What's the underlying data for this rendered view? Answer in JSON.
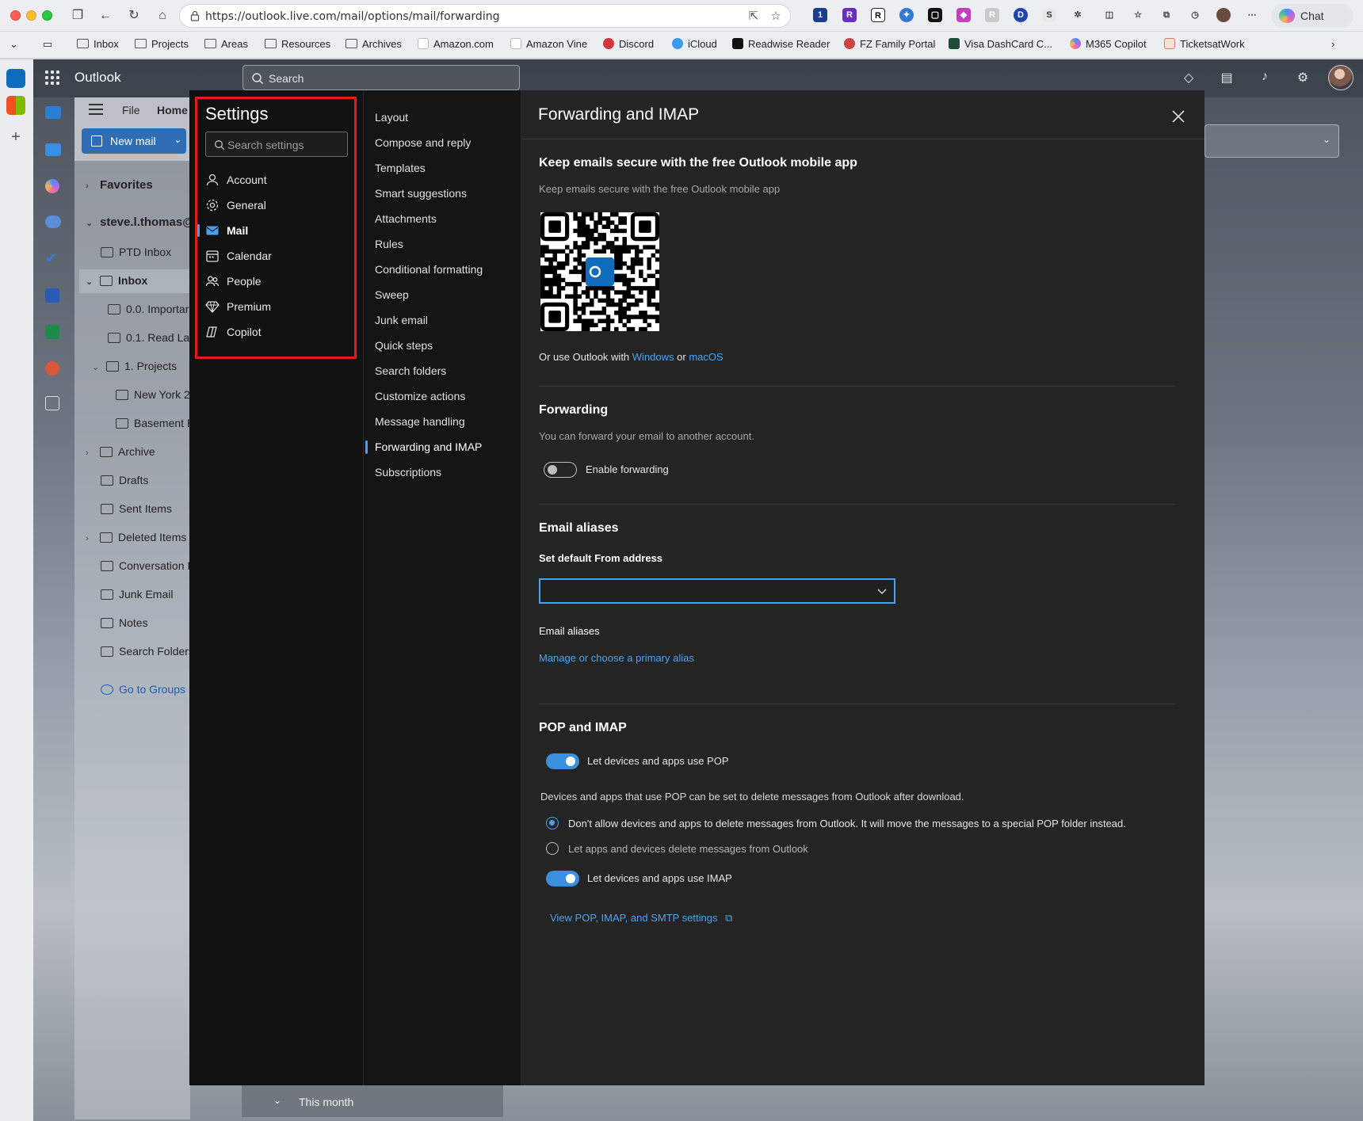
{
  "browser": {
    "url": "https://outlook.live.com/mail/options/mail/forwarding",
    "chat_label": "Chat",
    "bookmarks": [
      "Inbox",
      "Projects",
      "Areas",
      "Resources",
      "Archives",
      "Amazon.com",
      "Amazon Vine",
      "Discord",
      "iCloud",
      "Readwise Reader",
      "FZ Family Portal",
      "Visa DashCard C...",
      "M365 Copilot",
      "TicketsatWork"
    ]
  },
  "app": {
    "title": "Outlook",
    "search_placeholder": "Search",
    "ribbon_tabs": [
      "File",
      "Home"
    ],
    "new_mail_label": "New mail",
    "favorites_label": "Favorites",
    "account": "steve.l.thomas@",
    "folders": [
      "PTD Inbox",
      "Inbox",
      "0.0. Importar",
      "0.1. Read Lat",
      "1. Projects",
      "New York 2",
      "Basement E",
      "Archive",
      "Drafts",
      "Sent Items",
      "Deleted Items",
      "Conversation I",
      "Junk Email",
      "Notes",
      "Search Folders"
    ],
    "go_to_groups": "Go to Groups",
    "this_month": "This month"
  },
  "settings": {
    "title": "Settings",
    "search_placeholder": "Search settings",
    "categories": [
      "Account",
      "General",
      "Mail",
      "Calendar",
      "People",
      "Premium",
      "Copilot"
    ],
    "active_category": "Mail",
    "subcategories": [
      "Layout",
      "Compose and reply",
      "Templates",
      "Smart suggestions",
      "Attachments",
      "Rules",
      "Conditional formatting",
      "Sweep",
      "Junk email",
      "Quick steps",
      "Search folders",
      "Customize actions",
      "Message handling",
      "Forwarding and IMAP",
      "Subscriptions"
    ],
    "active_subcategory": "Forwarding and IMAP"
  },
  "content": {
    "title": "Forwarding and IMAP",
    "mobile": {
      "heading": "Keep emails secure with the free Outlook mobile app",
      "description": "Keep emails secure with the free Outlook mobile app",
      "use_prefix": "Or use Outlook with",
      "windows_link": "Windows",
      "or_word": "or",
      "macos_link": "macOS"
    },
    "forwarding": {
      "heading": "Forwarding",
      "description": "You can forward your email to another account.",
      "toggle_label": "Enable forwarding",
      "enabled": false
    },
    "aliases": {
      "heading": "Email aliases",
      "default_from_label": "Set default From address",
      "default_from_value": "",
      "aliases_label": "Email aliases",
      "manage_link": "Manage or choose a primary alias"
    },
    "pop_imap": {
      "heading": "POP and IMAP",
      "pop_label": "Let devices and apps use POP",
      "pop_enabled": true,
      "pop_desc": "Devices and apps that use POP can be set to delete messages from Outlook after download.",
      "option_dont_allow": "Don't allow devices and apps to delete messages from Outlook. It will move the messages to a special POP folder instead.",
      "option_allow": "Let apps and devices delete messages from Outlook",
      "selected_option": "dont_allow",
      "imap_label": "Let devices and apps use IMAP",
      "imap_enabled": true,
      "settings_link": "View POP, IMAP, and SMTP settings"
    }
  },
  "colors": {
    "accent": "#4aa0f0",
    "highlight_box": "#e21b1b",
    "toggle_on": "#3b8fe0"
  }
}
